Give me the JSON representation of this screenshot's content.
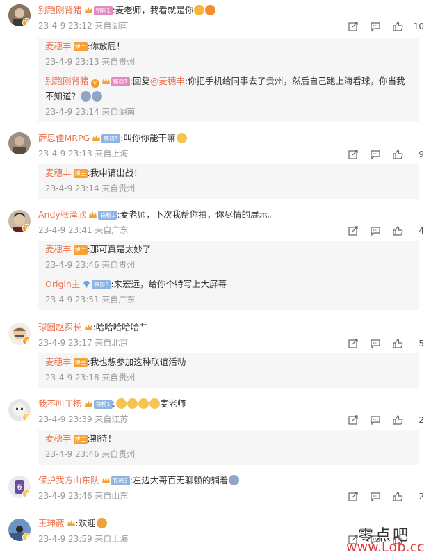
{
  "colors": {
    "name": "#eb7350",
    "meta": "#999999",
    "reply_bg": "#f6f6f6"
  },
  "comments": [
    {
      "user": "别跑刚背猪",
      "fan_badge": "铭粉1",
      "text": ":麦老师，我看就是你",
      "meta": "23-4-9 23:12 来自湖南",
      "likes": "10",
      "replies": [
        {
          "user": "麦穗丰",
          "role": "博主",
          "text": ":你放屁！",
          "meta": "23-4-9 23:13 来自贵州"
        },
        {
          "user": "别跑刚背猪",
          "fan_badge": "铭粉1",
          "prefix": ":回复",
          "mention": "@麦穗丰",
          "text_a": ":你把手机给同事去了贵州，然后自己跑上海看球，你当我",
          "text_b": "不知道？",
          "meta": "23-4-9 23:14 来自湖南"
        }
      ]
    },
    {
      "user": "薛思佳MRPG",
      "fan_badge": "铁粉1",
      "text": ":叫你你能干嘛",
      "meta": "23-4-9 23:13 来自上海",
      "likes": "9",
      "replies": [
        {
          "user": "麦穗丰",
          "role": "博主",
          "text": ":我申请出战！",
          "meta": "23-4-9 23:14 来自贵州"
        }
      ]
    },
    {
      "user": "Andy张泽欣",
      "fan_badge": "铁粉1",
      "text": ":麦老师，下次我帮你拍，你尽情的展示。",
      "meta": "23-4-9 23:41 来自广东",
      "likes": "4",
      "replies": [
        {
          "user": "麦穗丰",
          "role": "博主",
          "text": ":那可真是太妙了",
          "meta": "23-4-9 23:46 来自贵州"
        },
        {
          "user": "Origin主",
          "fan_badge": "铁粉3",
          "text": ":来宏远，给你个特写上大屏幕",
          "meta": "23-4-9 23:51 来自广东"
        }
      ]
    },
    {
      "user": "球圈赵探长",
      "text": ":哈哈哈哈哈艹",
      "meta": "23-4-9 23:17 来自北京",
      "likes": "5",
      "replies": [
        {
          "user": "麦穗丰",
          "role": "博主",
          "text": ":我也想参加这种联谊活动",
          "meta": "23-4-9 23:18 来自贵州"
        }
      ]
    },
    {
      "user": "我不叫丁扬",
      "fan_badge": "铁粉1",
      "text": "麦老师",
      "meta": "23-4-9 23:39 来自江苏",
      "likes": "2",
      "replies": [
        {
          "user": "麦穗丰",
          "role": "博主",
          "text": ":期待！",
          "meta": "23-4-9 23:46 来自贵州"
        }
      ]
    },
    {
      "user": "保护我方山东队",
      "fan_badge": "铁粉3",
      "text": ":左边大哥百无聊赖的躺着",
      "meta": "23-4-9 23:46 来自山东",
      "likes": "2",
      "replies": []
    },
    {
      "user": "王珅藏",
      "text": ":欢迎",
      "meta": "23-4-9 23:59 来自上海",
      "likes": "",
      "replies": []
    }
  ],
  "icons": {
    "share": "share-icon",
    "comment": "comment-icon",
    "like": "like-icon"
  },
  "watermark": {
    "line1": "零点吧",
    "line2": "www.Ldb.cc"
  }
}
